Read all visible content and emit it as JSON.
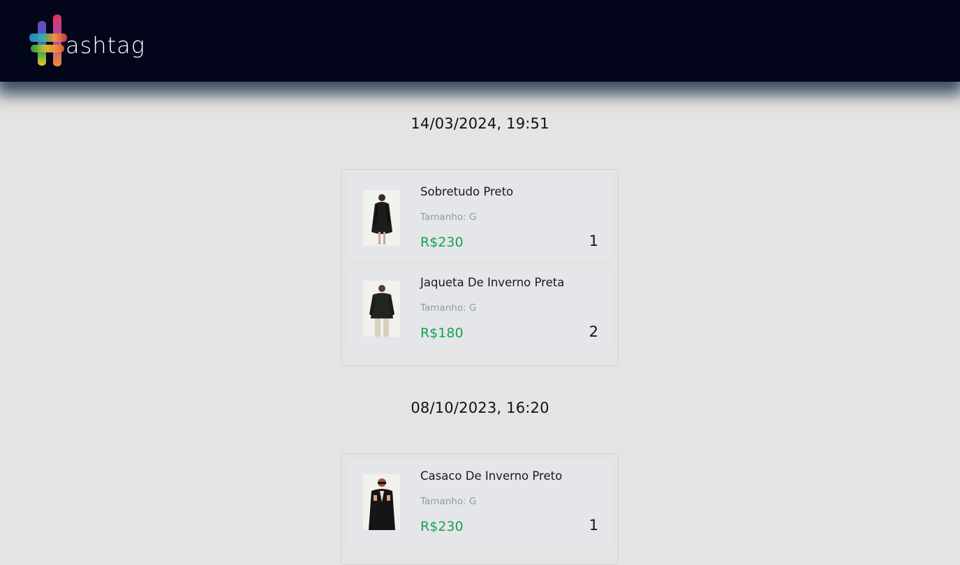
{
  "header": {
    "logo_text": "ashtag",
    "logo_icon": "hashtag-logo-icon"
  },
  "orders": [
    {
      "date": "14/03/2024, 19:51",
      "items": [
        {
          "name": "Sobretudo Preto",
          "size": "Tamanho: G",
          "price": "R$230",
          "quantity": "1",
          "image": "black-overcoat-photo"
        },
        {
          "name": "Jaqueta De Inverno Preta",
          "size": "Tamanho: G",
          "price": "R$180",
          "quantity": "2",
          "image": "black-winter-jacket-photo"
        }
      ]
    },
    {
      "date": "08/10/2023, 16:20",
      "items": [
        {
          "name": "Casaco De Inverno Preto",
          "size": "Tamanho: G",
          "price": "R$230",
          "quantity": "1",
          "image": "black-winter-coat-photo"
        }
      ]
    }
  ],
  "colors": {
    "header_bg": "#03061a",
    "page_bg": "#e5e4e2",
    "price": "#17a34a",
    "size_text": "#8d9aa8"
  }
}
